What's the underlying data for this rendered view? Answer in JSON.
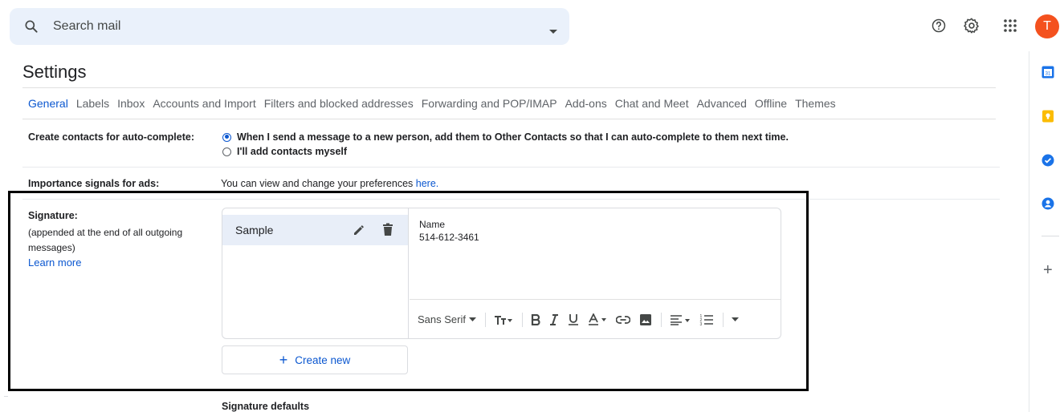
{
  "search": {
    "placeholder": "Search mail"
  },
  "avatar": {
    "initial": "T",
    "color": "#f4511e"
  },
  "settings": {
    "title": "Settings"
  },
  "tabs": [
    {
      "label": "General",
      "active": true
    },
    {
      "label": "Labels"
    },
    {
      "label": "Inbox"
    },
    {
      "label": "Accounts and Import"
    },
    {
      "label": "Filters and blocked addresses"
    },
    {
      "label": "Forwarding and POP/IMAP"
    },
    {
      "label": "Add-ons"
    },
    {
      "label": "Chat and Meet"
    },
    {
      "label": "Advanced"
    },
    {
      "label": "Offline"
    },
    {
      "label": "Themes"
    }
  ],
  "contacts": {
    "label": "Create contacts for auto-complete:",
    "option1": "When I send a message to a new person, add them to Other Contacts so that I can auto-complete to them next time.",
    "option2": "I'll add contacts myself",
    "selected": "option1"
  },
  "ads": {
    "label": "Importance signals for ads:",
    "text": "You can view and change your preferences ",
    "link": "here."
  },
  "signature": {
    "label": "Signature:",
    "sublabel": "(appended at the end of all outgoing messages)",
    "learn_more": "Learn more",
    "items": [
      {
        "name": "Sample"
      }
    ],
    "editor": {
      "line1": "Name",
      "line2": "514-612-3461"
    },
    "toolbar": {
      "font": "Sans Serif"
    },
    "create_new": "Create new",
    "defaults_heading": "Signature defaults"
  },
  "colors": {
    "accent": "#0b57d0",
    "selected_bg": "#e8eef8",
    "search_bg": "#eaf1fb"
  }
}
